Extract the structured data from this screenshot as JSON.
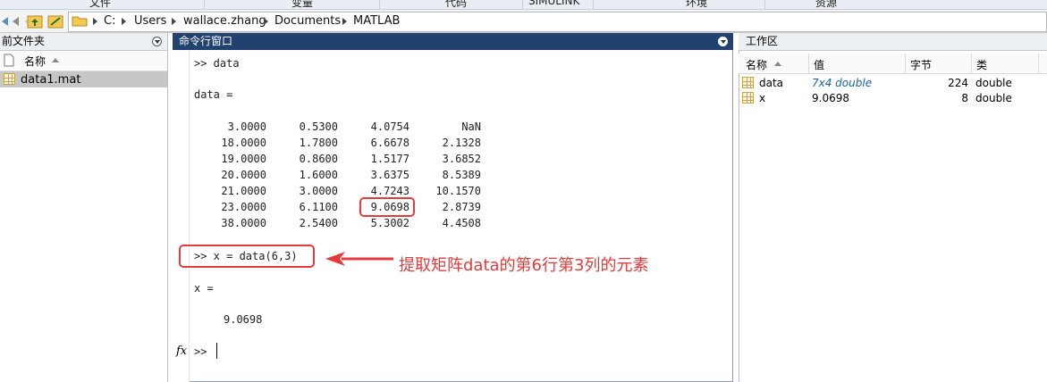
{
  "toolstrip_tabs": [
    "文件",
    "变量",
    "代码",
    "SIMULINK",
    "环境",
    "资源"
  ],
  "address": {
    "path": [
      "C:",
      "Users",
      "wallace.zhang",
      "Documents",
      "MATLAB"
    ]
  },
  "current_folder": {
    "title": "前文件夹",
    "col_name": "名称",
    "files": [
      "data1.mat"
    ]
  },
  "command_window": {
    "title": "命令行窗口",
    "cmd1": ">> data",
    "data_label": "data =",
    "matrix": [
      [
        "3.0000",
        "0.5300",
        "4.0754",
        "NaN"
      ],
      [
        "18.0000",
        "1.7800",
        "6.6678",
        "2.1328"
      ],
      [
        "19.0000",
        "0.8600",
        "1.5177",
        "3.6852"
      ],
      [
        "20.0000",
        "1.6000",
        "3.6375",
        "8.5389"
      ],
      [
        "21.0000",
        "3.0000",
        "4.7243",
        "10.1570"
      ],
      [
        "23.0000",
        "6.1100",
        "9.0698",
        "2.8739"
      ],
      [
        "38.0000",
        "2.5400",
        "5.3002",
        "4.4508"
      ]
    ],
    "cmd2": ">> x = data(6,3)",
    "x_label": "x =",
    "x_value": "9.0698",
    "fx": "fx",
    "prompt": ">>"
  },
  "annotation": {
    "text": "提取矩阵data的第6行第3列的元素",
    "color": "#e53b3b"
  },
  "workspace": {
    "title": "工作区",
    "columns": [
      "名称",
      "值",
      "字节",
      "类"
    ],
    "rows": [
      {
        "name": "data",
        "value": "7x4 double",
        "bytes": "224",
        "class": "double"
      },
      {
        "name": "x",
        "value": "9.0698",
        "bytes": "8",
        "class": "double"
      }
    ]
  }
}
